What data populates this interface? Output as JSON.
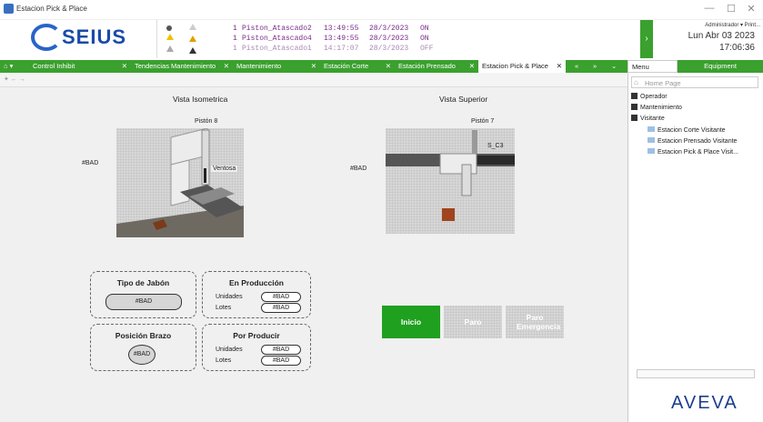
{
  "window": {
    "title": "Estacion Pick & Place",
    "minimize": "—",
    "maximize": "☐",
    "close": "✕"
  },
  "header": {
    "brand": "SEIUS",
    "alarms": [
      {
        "count": "1",
        "name": "Piston_Atascado2",
        "time": "13:49:55",
        "date": "28/3/2023",
        "state": "ON"
      },
      {
        "count": "1",
        "name": "Piston_Atascado4",
        "time": "13:49:55",
        "date": "28/3/2023",
        "state": "ON"
      },
      {
        "count": "1",
        "name": "Piston_Atascado1",
        "time": "14:17:07",
        "date": "28/3/2023",
        "state": "OFF"
      }
    ],
    "alarm_colors": {
      "active": "#7a2a8a",
      "inactive": "#a98ab5"
    },
    "user": "Administrador ▾  Print...",
    "date": "Lun Abr 03 2023",
    "time": "17:06:36",
    "nav_arrow": "›"
  },
  "tabs": [
    {
      "label": "Control Inhibit",
      "close": "✕"
    },
    {
      "label": "Tendencias Mantenimiento",
      "close": "✕"
    },
    {
      "label": "Mantenimiento",
      "close": "✕"
    },
    {
      "label": "Estación Corte",
      "close": "✕"
    },
    {
      "label": "Estación Prensado",
      "close": "✕"
    },
    {
      "label": "Estacion Pick & Place",
      "close": "✕"
    }
  ],
  "tab_nav": {
    "prev": "«",
    "next": "»",
    "down": "⌄",
    "home": "⌂ ▾"
  },
  "side_tabs": {
    "menu": "Menu",
    "equipment": "Equipment"
  },
  "nav": {
    "back": "✦ ← →"
  },
  "main": {
    "iso": {
      "title": "Vista Isometrica",
      "piston": "Pistón 8",
      "ventosa": "Ventosa",
      "bad": "#BAD"
    },
    "top": {
      "title": "Vista Superior",
      "piston": "Pistón 7",
      "sensor": "S_C3",
      "bad": "#BAD"
    },
    "tipo": {
      "label": "Tipo de Jabón",
      "value": "#BAD"
    },
    "posicion": {
      "label": "Posición Brazo",
      "value": "#BAD"
    },
    "produccion": {
      "label": "En Producción",
      "unidades_label": "Unidades",
      "unidades": "#BAD",
      "lotes_label": "Lotes",
      "lotes": "#BAD"
    },
    "producir": {
      "label": "Por Producir",
      "unidades_label": "Unidades",
      "unidades": "#BAD",
      "lotes_label": "Lotes",
      "lotes": "#BAD"
    },
    "buttons": {
      "inicio": "Inicio",
      "paro": "Paro",
      "emergencia": "Paro Emergencia"
    },
    "colors": {
      "inicio": "#1fa01f",
      "paro": "#a8a8a8",
      "accent": "#3aa02e"
    }
  },
  "panel": {
    "home": "Home Page",
    "tree": [
      {
        "label": "Operador",
        "type": "plus"
      },
      {
        "label": "Mantenimiento",
        "type": "plus"
      },
      {
        "label": "Visitante",
        "type": "minus"
      }
    ],
    "visitante_items": [
      "Estacion Corte Visitante",
      "Estacion Prensado Visitante",
      "Estacion Pick & Place Visit..."
    ],
    "brand": "AVEVA"
  }
}
